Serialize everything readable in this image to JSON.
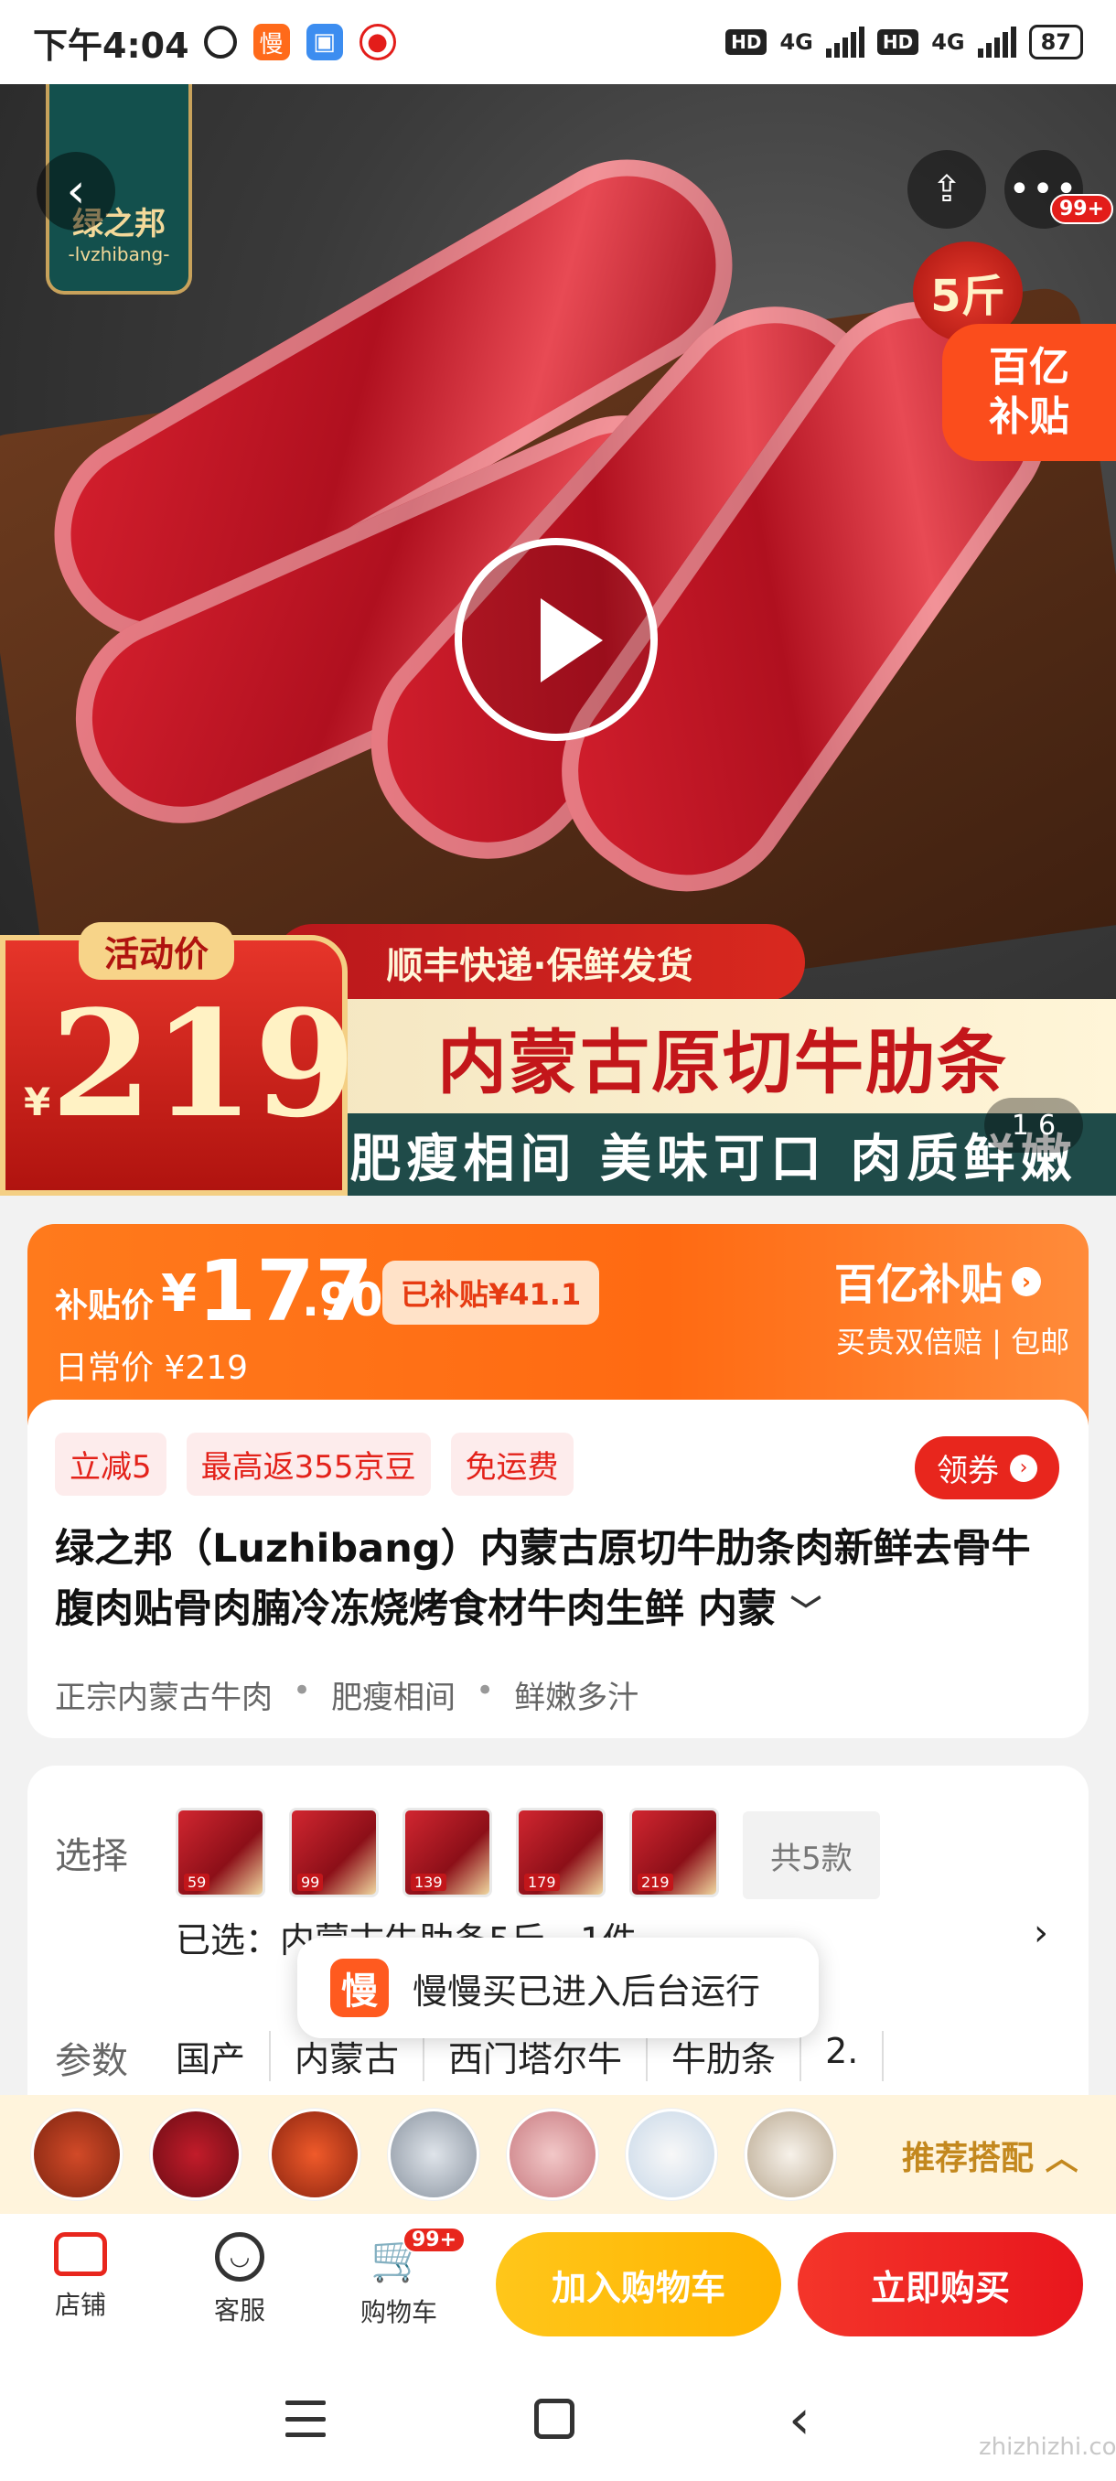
{
  "status_bar": {
    "time": "下午4:04",
    "app_icon_1": "慢",
    "hd_1": "HD",
    "net_1": "4G",
    "hd_2": "HD",
    "net_2": "4G",
    "battery": "87"
  },
  "hero": {
    "brand_name": "绿之邦",
    "brand_en": "-lvzhibang-",
    "weight_tag": "5斤",
    "cart_count": "99+",
    "subsidy_line1": "百亿",
    "subsidy_line2": "补贴",
    "activity_label": "活动价",
    "activity_currency": "¥",
    "activity_price": "219",
    "ship_text": "顺丰快递·保鲜发货",
    "main_text": "内蒙古原切牛肋条",
    "sub_text": "肥瘦相间 美味可口 肉质鲜嫩",
    "page_current": "1",
    "page_total": "6"
  },
  "price": {
    "label": "补贴价",
    "currency": "¥",
    "integer": "177",
    "decimal": ".90",
    "subsidized": "已补贴¥41.1",
    "daily_price": "日常价 ¥219",
    "brand": "百亿补贴",
    "note": "买贵双倍赔 | 包邮"
  },
  "info": {
    "chips": [
      "立减5",
      "最高返355京豆",
      "免运费"
    ],
    "coupon_label": "领券",
    "title": "绿之邦（Luzhibang）内蒙古原切牛肋条肉新鲜去骨牛腹肉贴骨肉腩冷冻烧烤食材牛肉生鲜 内蒙",
    "features": [
      "正宗内蒙古牛肉",
      "肥瘦相间",
      "鲜嫩多汁"
    ]
  },
  "options": {
    "select_label": "选择",
    "thumb_prices": [
      "59",
      "99",
      "139",
      "179",
      "219"
    ],
    "total": "共5款",
    "selected": "已选：内蒙古牛肋条5斤，1件",
    "param_label": "参数",
    "params": [
      "国产",
      "内蒙古",
      "西门塔尔牛",
      "牛肋条",
      "2."
    ]
  },
  "toast": {
    "icon": "慢",
    "text": "慢慢买已进入后台运行"
  },
  "recommend": {
    "label": "推荐搭配"
  },
  "bottom_bar": {
    "store": "店铺",
    "service": "客服",
    "cart": "购物车",
    "cart_badge": "99+",
    "add_cart": "加入购物车",
    "buy_now": "立即购买"
  },
  "watermark": "zhizhizhi.com"
}
